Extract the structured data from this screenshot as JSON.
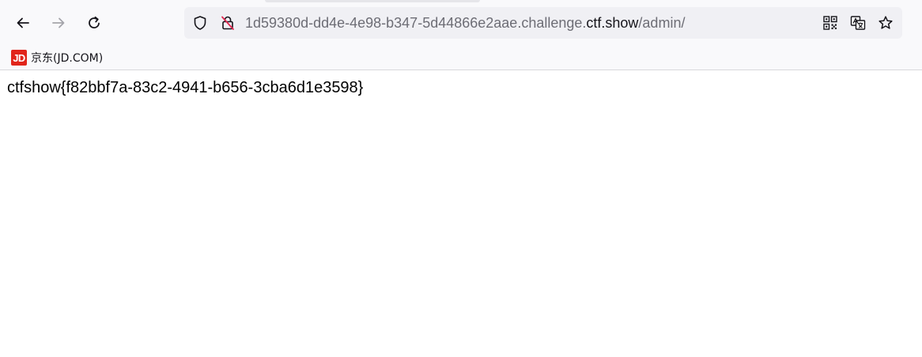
{
  "toolbar": {
    "url_prefix": "1d59380d-dd4e-4e98-b347-5d44866e2aae.challenge.",
    "url_domain": "ctf.show",
    "url_path": "/admin/",
    "icons": [
      "back-icon",
      "forward-icon",
      "reload-icon",
      "shield-icon",
      "insecure-lock-icon",
      "qr-code-icon",
      "translate-icon",
      "bookmark-star-icon"
    ]
  },
  "bookmarks": [
    {
      "logo": "JD",
      "label": "京东(JD.COM)"
    }
  ],
  "page": {
    "body_text": "ctfshow{f82bbf7a-83c2-4941-b656-3cba6d1e3598}"
  },
  "colors": {
    "toolbar_bg": "#f9f9fb",
    "urlbar_bg": "#f0f0f4",
    "jd_red": "#e1251b",
    "insecure_red": "#e22850"
  }
}
